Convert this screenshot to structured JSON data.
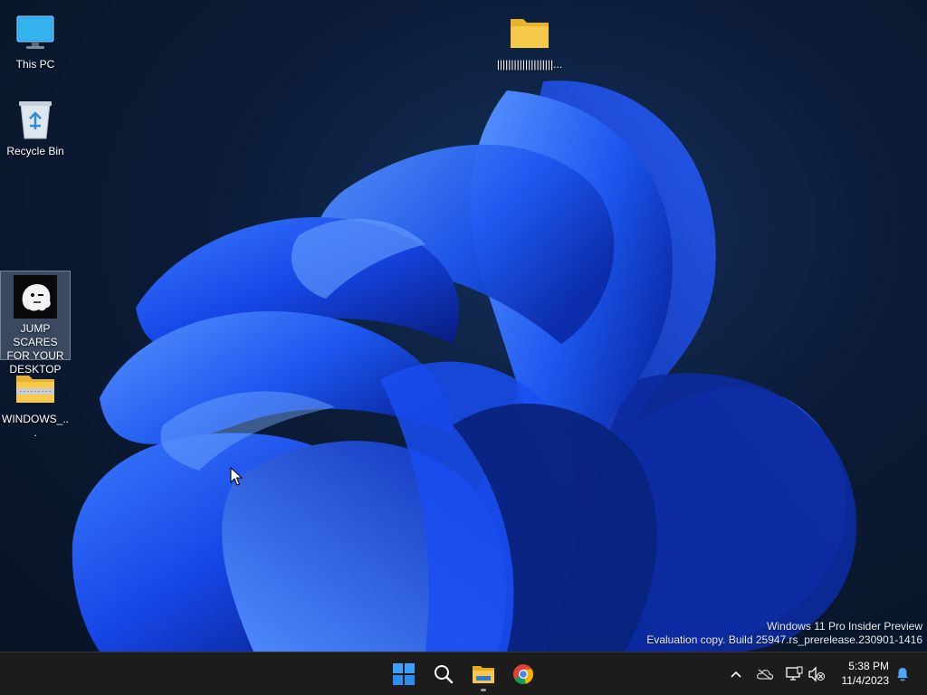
{
  "desktop": {
    "icons": [
      {
        "label": "This PC",
        "icon": "monitor-icon"
      },
      {
        "label": "Recycle Bin",
        "icon": "recycle-bin-icon"
      },
      {
        "label": "JUMP SCARES FOR YOUR DESKTOP",
        "icon": "ghost-app-icon",
        "selected": true
      },
      {
        "label": "WINDOWS_...",
        "icon": "zip-folder-icon"
      },
      {
        "label": "||||||||||||||||||||...",
        "icon": "folder-icon"
      }
    ]
  },
  "watermark": {
    "line1": "Windows 11 Pro Insider Preview",
    "line2": "Evaluation copy. Build 25947.rs_prerelease.230901-1416"
  },
  "taskbar": {
    "pinned": [
      {
        "name": "Start",
        "icon": "windows-start-icon"
      },
      {
        "name": "Search",
        "icon": "search-icon"
      },
      {
        "name": "File Explorer",
        "icon": "file-explorer-icon",
        "active": true
      },
      {
        "name": "Google Chrome",
        "icon": "chrome-icon"
      }
    ],
    "tray": [
      {
        "icon": "chevron-up-icon"
      },
      {
        "icon": "onedrive-icon"
      },
      {
        "icon": "network-icon"
      },
      {
        "icon": "volume-muted-icon"
      }
    ],
    "clock": {
      "time": "5:38 PM",
      "date": "11/4/2023"
    },
    "notification_icon": "bell-icon"
  },
  "colors": {
    "accent": "#1a5cff",
    "taskbar": "#1c1c1c",
    "desktop_bg": "#0b1b36",
    "folder": "#f7c948"
  }
}
